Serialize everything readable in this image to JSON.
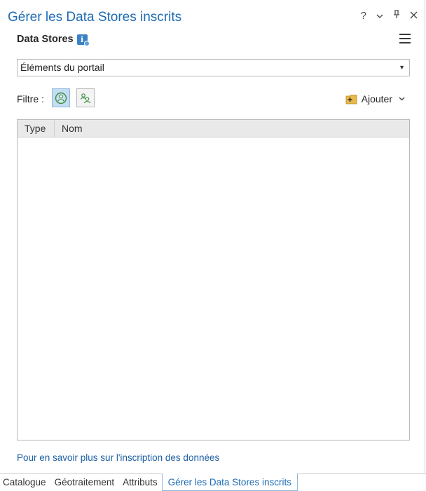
{
  "pane": {
    "title": "Gérer les Data Stores inscrits",
    "controls": {
      "help": "?",
      "options": "⌄",
      "pin": "ᵖ",
      "close": "✕"
    }
  },
  "subhead": {
    "label": "Data Stores",
    "icon": "info-icon"
  },
  "source_select": {
    "value": "Éléments du portail"
  },
  "filter": {
    "label": "Filtre :",
    "buttons": [
      {
        "icon": "portal-user-icon",
        "active": true
      },
      {
        "icon": "shared-users-icon",
        "active": false
      }
    ]
  },
  "add": {
    "label": "Ajouter",
    "icon": "add-data-store-icon"
  },
  "table": {
    "columns": [
      "Type",
      "Nom"
    ],
    "rows": []
  },
  "learn_more_link": "Pour en savoir plus sur l'inscription des données",
  "tabs": [
    {
      "label": "Catalogue",
      "active": false
    },
    {
      "label": "Géotraitement",
      "active": false
    },
    {
      "label": "Attributs",
      "active": false
    },
    {
      "label": "Gérer les Data Stores inscrits",
      "active": true
    }
  ],
  "colors": {
    "accent": "#1d6bb5",
    "active_filter": "#c5ddf2",
    "header_bg": "#e9e9e9"
  }
}
